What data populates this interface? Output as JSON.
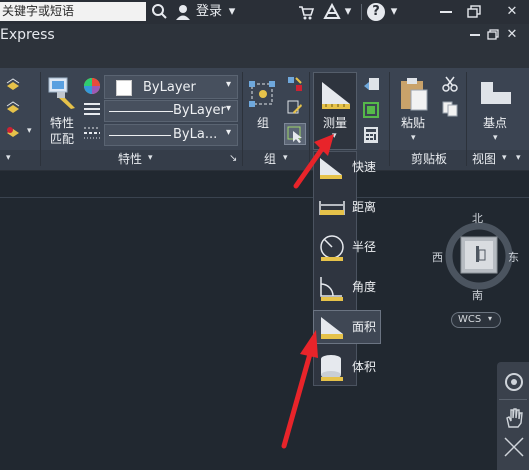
{
  "title_bar": {
    "search_placeholder": "关键字或短语",
    "login_label": "登录",
    "help_label": "?"
  },
  "tab_bar": {
    "active_tab": "Express"
  },
  "ribbon": {
    "properties_panel": {
      "match_properties_line1": "特性",
      "match_properties_line2": "匹配",
      "color_value": "ByLayer",
      "linetype_value": "ByLayer",
      "lineweight_value": "ByLa...",
      "panel_title": "特性"
    },
    "group_panel": {
      "group_label": "组",
      "panel_title": "组"
    },
    "measure": {
      "label": "测量"
    },
    "clipboard_panel": {
      "paste_label": "粘贴",
      "panel_title": "剪贴板"
    },
    "view_panel": {
      "base_point_label": "基点",
      "panel_title": "视图"
    }
  },
  "measure_menu": {
    "items": [
      {
        "label": "快速",
        "icon": "quick-measure-icon"
      },
      {
        "label": "距离",
        "icon": "distance-icon"
      },
      {
        "label": "半径",
        "icon": "radius-icon"
      },
      {
        "label": "角度",
        "icon": "angle-icon"
      },
      {
        "label": "面积",
        "icon": "area-icon",
        "highlighted": true
      },
      {
        "label": "体积",
        "icon": "volume-icon"
      }
    ]
  },
  "viewcube": {
    "north": "北",
    "south": "南",
    "east": "东",
    "west": "西",
    "wcs": "WCS"
  },
  "colors": {
    "annotation_arrow": "#e8242a",
    "ribbon_bg": "#3b4452",
    "workspace_bg": "#212830"
  }
}
